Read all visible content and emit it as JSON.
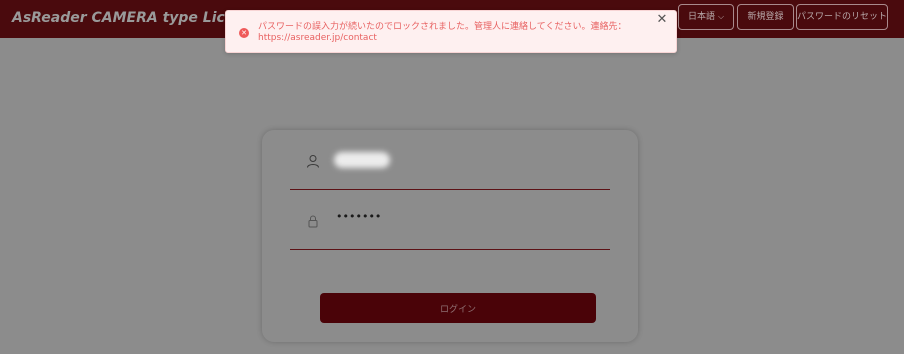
{
  "header": {
    "title": "AsReader CAMERA type License Sy",
    "language_label": "日本語",
    "register_label": "新規登録",
    "reset_password_label": "パスワードのリセット",
    "brand_color": "#4a0a0d"
  },
  "login": {
    "username_icon": "user-icon",
    "password_icon": "lock-icon",
    "password_mask": "•••••••",
    "submit_label": "ログイン"
  },
  "alert": {
    "type": "error",
    "icon": "error-circle-icon",
    "message": "パスワードの誤入力が続いたのでロックされました。管理人に連絡してください。連絡先：https://asreader.jp/contact",
    "close_icon": "close-icon",
    "color": "#e86262"
  }
}
